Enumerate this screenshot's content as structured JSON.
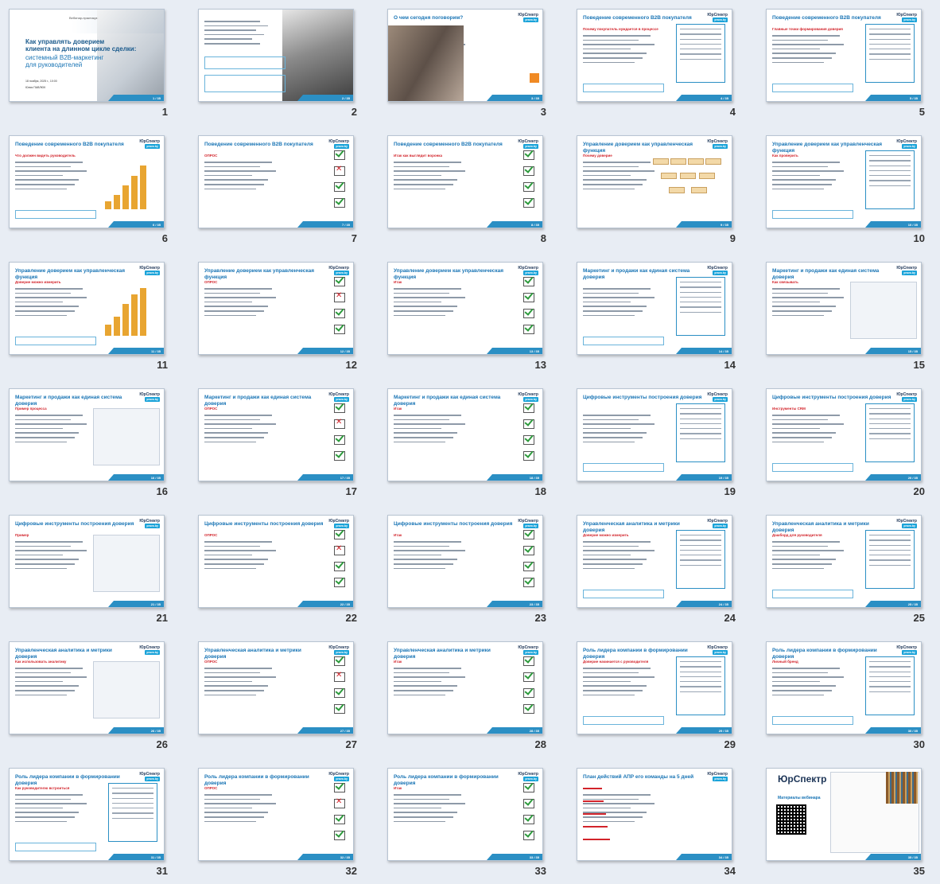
{
  "brand": "ЮрСпектр",
  "brand_sub": "pravo.by",
  "cover": {
    "title_line1": "Как управлять доверием",
    "title_line2": "клиента на длинном цикле сделки:",
    "subtitle_line1": "системный B2B-маркетинг",
    "subtitle_line2": "для руководителей",
    "date": "18 ноября, 2025 г., 10:00",
    "author": "Юлия ПАВЛЮК",
    "tagline": "Вебинар-практикум"
  },
  "slides": [
    {
      "n": "1",
      "title": "",
      "layout": "cover"
    },
    {
      "n": "2",
      "title": "",
      "layout": "speaker"
    },
    {
      "n": "3",
      "title": "О чем сегодня поговорим?",
      "layout": "agenda"
    },
    {
      "n": "4",
      "title": "Поведение современного B2B покупателя",
      "sub": "Почему покупатель нуждается в процессе",
      "layout": "text-box"
    },
    {
      "n": "5",
      "title": "Поведение современного B2B покупателя",
      "sub": "Главные точки формирования доверия",
      "layout": "text-box"
    },
    {
      "n": "6",
      "title": "Поведение современного B2B покупателя",
      "sub": "Что должен видеть руководитель",
      "layout": "bars"
    },
    {
      "n": "7",
      "title": "Поведение современного B2B покупателя",
      "sub": "ОПРОС",
      "layout": "poll"
    },
    {
      "n": "8",
      "title": "Поведение современного B2B покупателя",
      "sub": "Итак как выглядит воронка",
      "layout": "poll"
    },
    {
      "n": "9",
      "title": "Управление доверием как управленческая функция",
      "sub": "Почему доверие",
      "layout": "flow"
    },
    {
      "n": "10",
      "title": "Управление доверием как управленческая функция",
      "sub": "Как проверить",
      "layout": "text-box"
    },
    {
      "n": "11",
      "title": "Управление доверием как управленческая функция",
      "sub": "Доверие можно измерить",
      "layout": "bars2"
    },
    {
      "n": "12",
      "title": "Управление доверием как управленческая функция",
      "sub": "ОПРОС",
      "layout": "poll"
    },
    {
      "n": "13",
      "title": "Управление доверием как управленческая функция",
      "sub": "Итак",
      "layout": "poll"
    },
    {
      "n": "14",
      "title": "Маркетинг и продажи как единая система доверия",
      "sub": "",
      "layout": "text-box"
    },
    {
      "n": "15",
      "title": "Маркетинг и продажи как единая система доверия",
      "sub": "Как связывать",
      "layout": "screen"
    },
    {
      "n": "16",
      "title": "Маркетинг и продажи как единая система доверия",
      "sub": "Пример процесса",
      "layout": "screen"
    },
    {
      "n": "17",
      "title": "Маркетинг и продажи как единая система доверия",
      "sub": "ОПРОС",
      "layout": "poll"
    },
    {
      "n": "18",
      "title": "Маркетинг и продажи как единая система доверия",
      "sub": "Итак",
      "layout": "poll"
    },
    {
      "n": "19",
      "title": "Цифровые инструменты построения доверия",
      "sub": "",
      "layout": "text-box"
    },
    {
      "n": "20",
      "title": "Цифровые инструменты построения доверия",
      "sub": "Инструменты CRM",
      "layout": "text-box"
    },
    {
      "n": "21",
      "title": "Цифровые инструменты построения доверия",
      "sub": "Пример",
      "layout": "screen"
    },
    {
      "n": "22",
      "title": "Цифровые инструменты построения доверия",
      "sub": "ОПРОС",
      "layout": "poll"
    },
    {
      "n": "23",
      "title": "Цифровые инструменты построения доверия",
      "sub": "Итак",
      "layout": "poll"
    },
    {
      "n": "24",
      "title": "Управленческая аналитика и метрики доверия",
      "sub": "Доверие можно измерить",
      "layout": "text-box"
    },
    {
      "n": "25",
      "title": "Управленческая аналитика и метрики доверия",
      "sub": "Дашборд для руководителя",
      "layout": "text-box"
    },
    {
      "n": "26",
      "title": "Управленческая аналитика и метрики доверия",
      "sub": "Как использовать аналитику",
      "layout": "screen"
    },
    {
      "n": "27",
      "title": "Управленческая аналитика и метрики доверия",
      "sub": "ОПРОС",
      "layout": "poll"
    },
    {
      "n": "28",
      "title": "Управленческая аналитика и метрики доверия",
      "sub": "Итак",
      "layout": "poll"
    },
    {
      "n": "29",
      "title": "Роль лидера компании в формировании доверия",
      "sub": "Доверие начинается с руководителя",
      "layout": "text-box"
    },
    {
      "n": "30",
      "title": "Роль лидера компании в формировании доверия",
      "sub": "Личный бренд",
      "layout": "text-box"
    },
    {
      "n": "31",
      "title": "Роль лидера компании в формировании доверия",
      "sub": "Как руководителю встроиться",
      "layout": "text-box"
    },
    {
      "n": "32",
      "title": "Роль лидера компании в формировании доверия",
      "sub": "ОПРОС",
      "layout": "poll"
    },
    {
      "n": "33",
      "title": "Роль лидера компании в формировании доверия",
      "sub": "Итак",
      "layout": "poll"
    },
    {
      "n": "34",
      "title": "План действий АПР его команды на 5 дней",
      "sub": "",
      "layout": "plan"
    },
    {
      "n": "35",
      "title": "",
      "sub": "Материалы вебинара",
      "layout": "final"
    }
  ]
}
